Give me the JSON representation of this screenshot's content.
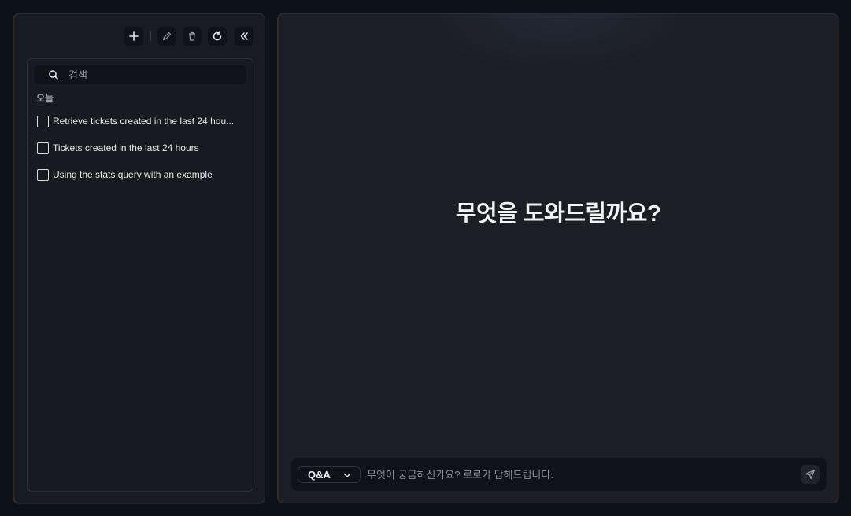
{
  "sidebar": {
    "toolbar": {
      "new_icon": "plus-icon",
      "edit_icon": "pencil-icon",
      "delete_icon": "trash-icon",
      "refresh_icon": "refresh-icon",
      "collapse_icon": "double-chevron-left-icon"
    },
    "search": {
      "placeholder": "검색",
      "value": ""
    },
    "section_label": "오늘",
    "items": [
      {
        "label": "Retrieve tickets created in the last 24 hou...",
        "checked": false
      },
      {
        "label": "Tickets created in the last 24 hours",
        "checked": false
      },
      {
        "label": "Using the stats query with an example",
        "checked": false
      }
    ]
  },
  "main": {
    "headline": "무엇을 도와드릴까요?",
    "composer": {
      "mode": "Q&A",
      "placeholder": "무엇이 궁금하신가요? 로로가 답해드립니다.",
      "value": "",
      "send_icon": "send-icon"
    }
  },
  "colors": {
    "background": "#0d111a",
    "panel": "#181b21",
    "accent_glow": "#ff7828"
  }
}
